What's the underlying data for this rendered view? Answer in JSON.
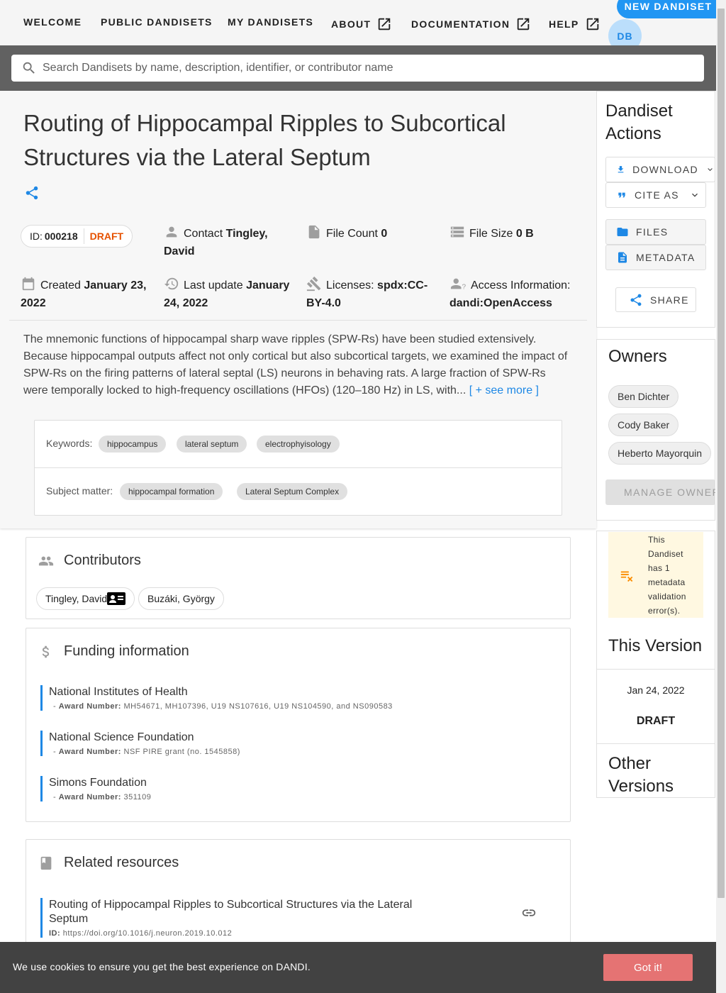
{
  "nav": {
    "welcome": "WELCOME",
    "public": "PUBLIC DANDISETS",
    "my": "MY DANDISETS",
    "about": "ABOUT",
    "documentation": "DOCUMENTATION",
    "help": "HELP",
    "new_dandiset": "NEW DANDISET",
    "avatar_initials": "DB"
  },
  "search": {
    "placeholder": "Search Dandisets by name, description, identifier, or contributor name"
  },
  "dandiset": {
    "title": "Routing of Hippocampal Ripples to Subcortical Structures via the Lateral Septum",
    "id_label": "ID:",
    "id": "000218",
    "status": "DRAFT",
    "contact_label": "Contact",
    "contact": "Tingley, David",
    "file_count_label": "File Count",
    "file_count": "0",
    "file_size_label": "File Size",
    "file_size": "0 B",
    "created_label": "Created",
    "created": "January 23, 2022",
    "updated_label": "Last update",
    "updated": "January 24, 2022",
    "licenses_label": "Licenses:",
    "license": "spdx:CC-BY-4.0",
    "access_label": "Access Information:",
    "access": "dandi:OpenAccess",
    "description": "The mnemonic functions of hippocampal sharp wave ripples (SPW-Rs) have been studied extensively. Because hippocampal outputs affect not only cortical but also subcortical targets, we examined the impact of SPW-Rs on the firing patterns of lateral septal (LS) neurons in behaving rats. A large fraction of SPW-Rs were temporally locked to high-frequency oscillations (HFOs) (120–180 Hz) in LS, with...",
    "see_more": "[ + see more ]"
  },
  "keywords": {
    "label": "Keywords:",
    "items": [
      "hippocampus",
      "lateral septum",
      "electrophyisology"
    ],
    "subject_label": "Subject matter:",
    "subjects": [
      "hippocampal formation",
      "Lateral Septum Complex"
    ]
  },
  "contributors": {
    "title": "Contributors",
    "people": [
      "Tingley, David",
      "Buzáki, György"
    ]
  },
  "funding": {
    "title": "Funding information",
    "award_label": "Award Number:",
    "items": [
      {
        "name": "National Institutes of Health",
        "award": "MH54671, MH107396, U19 NS107616, U19 NS104590, and NS090583"
      },
      {
        "name": "National Science Foundation",
        "award": "NSF PIRE grant (no. 1545858)"
      },
      {
        "name": "Simons Foundation",
        "award": "351109"
      }
    ]
  },
  "resources": {
    "title": "Related resources",
    "items": [
      {
        "name": "Routing of Hippocampal Ripples to Subcortical Structures via the Lateral Septum",
        "id_label": "ID:",
        "id": "https://doi.org/10.1016/j.neuron.2019.10.012"
      }
    ]
  },
  "actions": {
    "title": "Dandiset Actions",
    "download": "DOWNLOAD",
    "cite": "CITE AS",
    "files": "FILES",
    "metadata": "METADATA",
    "share": "SHARE"
  },
  "owners": {
    "title": "Owners",
    "people": [
      "Ben Dichter",
      "Cody Baker",
      "Heberto Mayorquin"
    ],
    "manage": "MANAGE OWNERS"
  },
  "validation": {
    "message": "This Dandiset has 1 metadata validation error(s)."
  },
  "versions": {
    "this_title": "This Version",
    "date": "Jan 24, 2022",
    "status": "DRAFT",
    "other_title": "Other Versions"
  },
  "cookie": {
    "message": "We use cookies to ensure you get the best experience on DANDI.",
    "button": "Got it!"
  },
  "colors": {
    "accent": "#2196f3",
    "draft": "#e65100",
    "cookie_button": "#e57373"
  }
}
